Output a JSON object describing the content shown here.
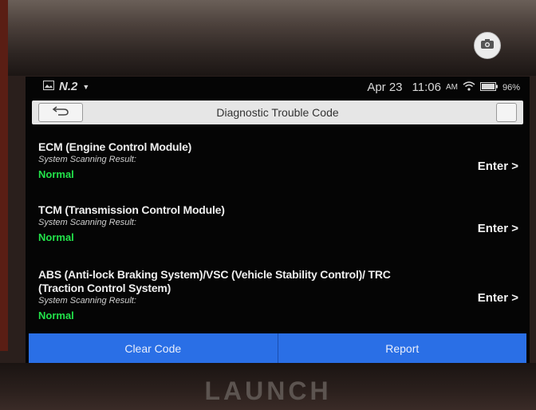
{
  "device": {
    "brand_logo": "LAUNCH"
  },
  "status_bar": {
    "left_label": "N.2",
    "date": "Apr 23",
    "time": "11:06",
    "network": "AM",
    "battery": "96%"
  },
  "header": {
    "title": "Diagnostic Trouble Code"
  },
  "modules": [
    {
      "name": "ECM (Engine Control Module)",
      "scan_label": "System Scanning Result:",
      "result": "Normal",
      "enter_label": "Enter >"
    },
    {
      "name": "TCM (Transmission Control Module)",
      "scan_label": "System Scanning Result:",
      "result": "Normal",
      "enter_label": "Enter >"
    },
    {
      "name": "ABS (Anti-lock Braking System)/VSC (Vehicle Stability Control)/ TRC (Traction Control System)",
      "scan_label": "System Scanning Result:",
      "result": "Normal",
      "enter_label": "Enter >"
    }
  ],
  "actions": {
    "clear_code": "Clear Code",
    "report": "Report"
  },
  "colors": {
    "accent_blue": "#2a6fe6",
    "status_green": "#22e34a"
  }
}
